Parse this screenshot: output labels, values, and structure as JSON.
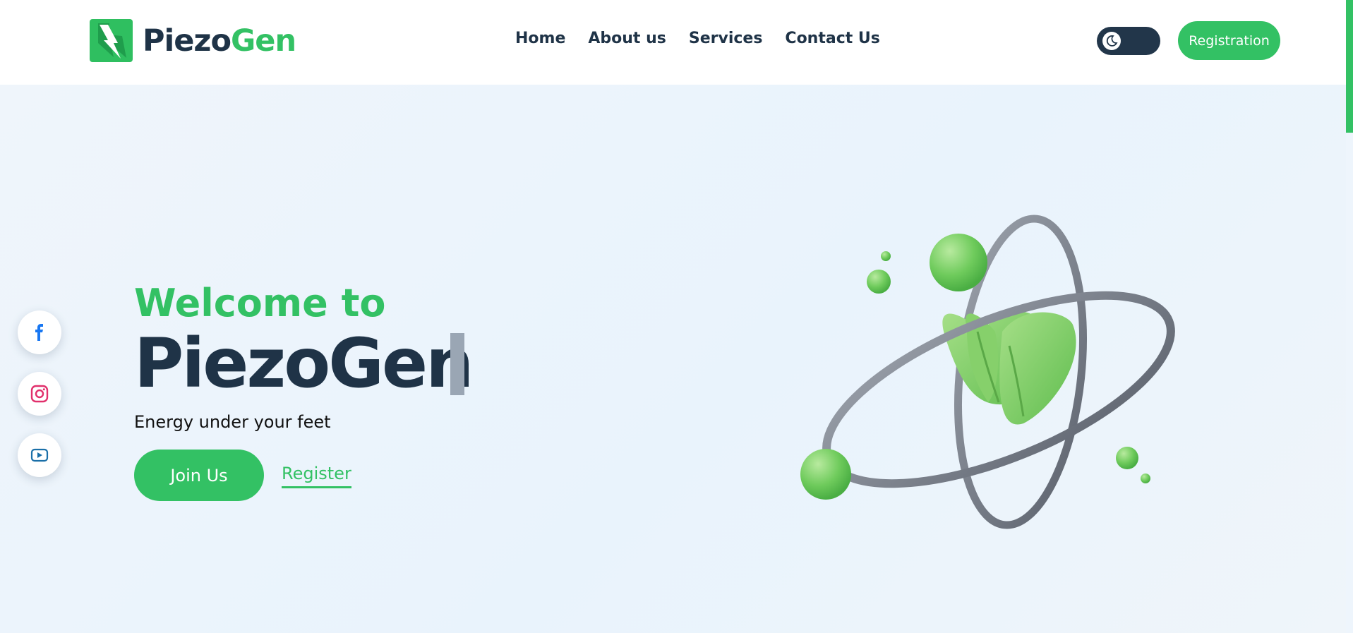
{
  "brand": {
    "name_part1": "Piezo",
    "name_part2": "Gen"
  },
  "nav": {
    "items": [
      "Home",
      "About us",
      "Services",
      "Contact Us"
    ]
  },
  "header": {
    "registration_label": "Registration",
    "theme_toggle_icon": "moon-icon"
  },
  "hero": {
    "welcome": "Welcome to",
    "title": "PiezoGen",
    "tagline": "Energy under your feet",
    "join_label": "Join Us",
    "register_label": "Register"
  },
  "social": [
    {
      "icon": "facebook-icon",
      "color": "#1877f2"
    },
    {
      "icon": "instagram-icon",
      "color": "#e1306c"
    },
    {
      "icon": "youtube-icon",
      "color": "#1a6fa8"
    }
  ],
  "colors": {
    "accent": "#33c164",
    "dark": "#1f3347",
    "background": "#eef5fc"
  }
}
